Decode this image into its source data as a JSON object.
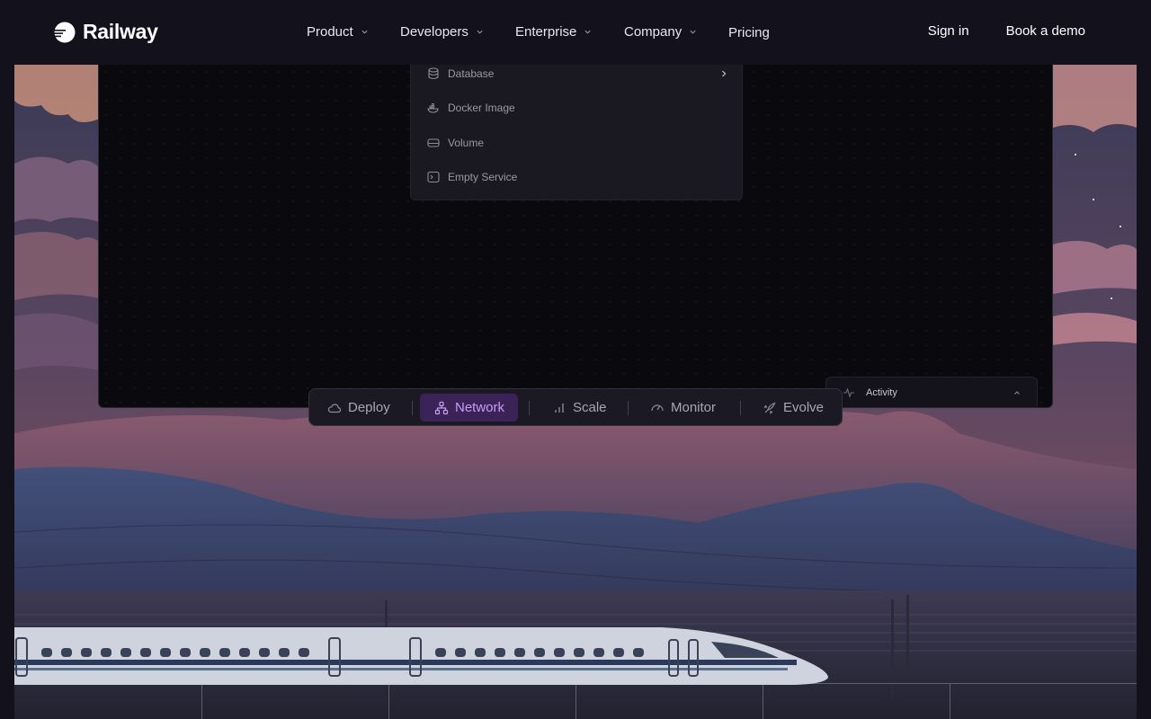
{
  "brand": {
    "name": "Railway"
  },
  "nav": {
    "items": [
      {
        "label": "Product",
        "has_dropdown": true
      },
      {
        "label": "Developers",
        "has_dropdown": true
      },
      {
        "label": "Enterprise",
        "has_dropdown": true
      },
      {
        "label": "Company",
        "has_dropdown": true
      },
      {
        "label": "Pricing",
        "has_dropdown": false
      }
    ],
    "sign_in": "Sign in",
    "book_demo": "Book a demo"
  },
  "service_menu": {
    "items": [
      {
        "label": "Database",
        "icon": "database-icon",
        "has_submenu": true
      },
      {
        "label": "Docker Image",
        "icon": "docker-icon",
        "has_submenu": false
      },
      {
        "label": "Volume",
        "icon": "volume-icon",
        "has_submenu": false
      },
      {
        "label": "Empty Service",
        "icon": "terminal-icon",
        "has_submenu": false
      }
    ]
  },
  "activity_panel": {
    "label": "Activity",
    "icon": "activity-icon"
  },
  "feature_tabs": {
    "active": "Network",
    "tabs": [
      {
        "label": "Deploy",
        "icon": "cloud-icon"
      },
      {
        "label": "Network",
        "icon": "network-icon"
      },
      {
        "label": "Scale",
        "icon": "bar-chart-icon"
      },
      {
        "label": "Monitor",
        "icon": "gauge-icon"
      },
      {
        "label": "Evolve",
        "icon": "rocket-icon"
      }
    ]
  },
  "colors": {
    "nav_bg": "#13111c",
    "accent_purple": "#c79cf5",
    "active_tab_bg": "#3b2358",
    "canvas_bg": "#0a090e"
  }
}
